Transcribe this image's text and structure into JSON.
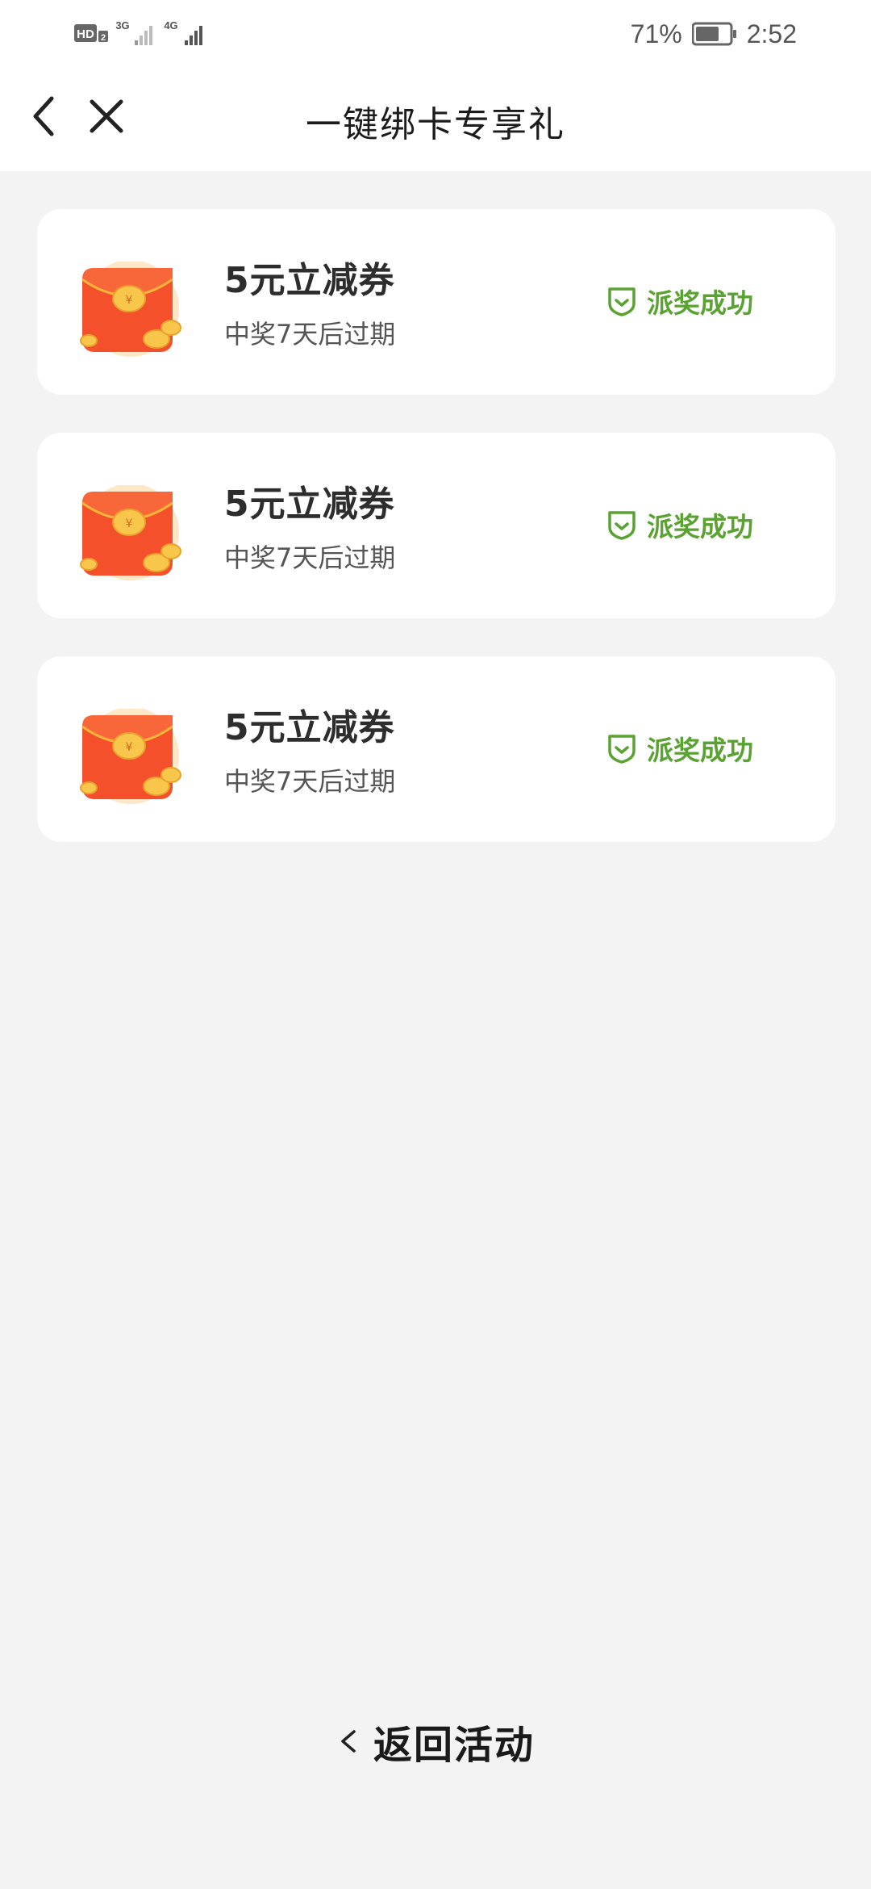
{
  "status_bar": {
    "hd_label": "HD",
    "sim_label": "2",
    "net1": "3G",
    "net2": "4G",
    "battery_percent": "71%",
    "battery_level": 0.71,
    "time": "2:52"
  },
  "nav": {
    "title": "一键绑卡专享礼"
  },
  "rewards": [
    {
      "title": "5元立减券",
      "subtitle": "中奖7天后过期",
      "status": "派奖成功"
    },
    {
      "title": "5元立减券",
      "subtitle": "中奖7天后过期",
      "status": "派奖成功"
    },
    {
      "title": "5元立减券",
      "subtitle": "中奖7天后过期",
      "status": "派奖成功"
    }
  ],
  "footer": {
    "back_label": "返回活动"
  },
  "colors": {
    "accent_green": "#5aa232",
    "envelope_red": "#f4502c",
    "background": "#f3f3f3"
  }
}
